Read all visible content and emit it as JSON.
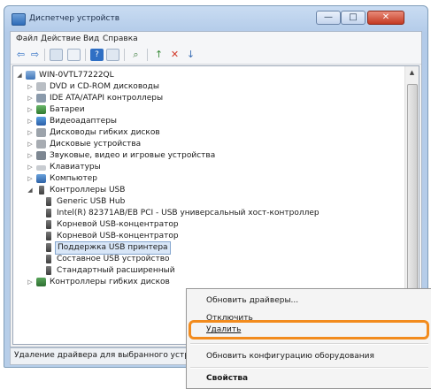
{
  "window": {
    "title": "Диспетчер устройств",
    "buttons": {
      "minimize": "—",
      "maximize": "□",
      "close": "✕"
    }
  },
  "menu": [
    "Файл",
    "Действие",
    "Вид",
    "Справка"
  ],
  "toolbar_icons": [
    "back-icon",
    "forward-icon",
    "show-hide-icon",
    "properties-icon",
    "help-icon",
    "view-icon",
    "scan-hardware-icon",
    "update-driver-icon",
    "uninstall-icon",
    "disable-icon"
  ],
  "tree": {
    "root": "WIN-0VTL77222QL",
    "categories": [
      "DVD и CD-ROM дисководы",
      "IDE ATA/ATAPI контроллеры",
      "Батареи",
      "Видеоадаптеры",
      "Дисководы гибких дисков",
      "Дисковые устройства",
      "Звуковые, видео и игровые устройства",
      "Клавиатуры",
      "Компьютер",
      "Контроллеры USB"
    ],
    "usb_children": [
      "Generic USB Hub",
      "Intel(R) 82371AB/EB PCI - USB универсальный хост-контроллер",
      "Корневой USB-концентратор",
      "Корневой USB-концентратор",
      "Поддержка USB принтера",
      "Составное USB устройство",
      "Стандартный расширенный"
    ],
    "last_category": "Контроллеры гибких дисков"
  },
  "status": "Удаление драйвера для выбранного устр",
  "context_menu": {
    "items": [
      "Обновить драйверы...",
      "Отключить",
      "Удалить",
      "Обновить конфигурацию оборудования",
      "Свойства"
    ],
    "highlighted": "Удалить",
    "highlight_color": "#f28b1d"
  }
}
